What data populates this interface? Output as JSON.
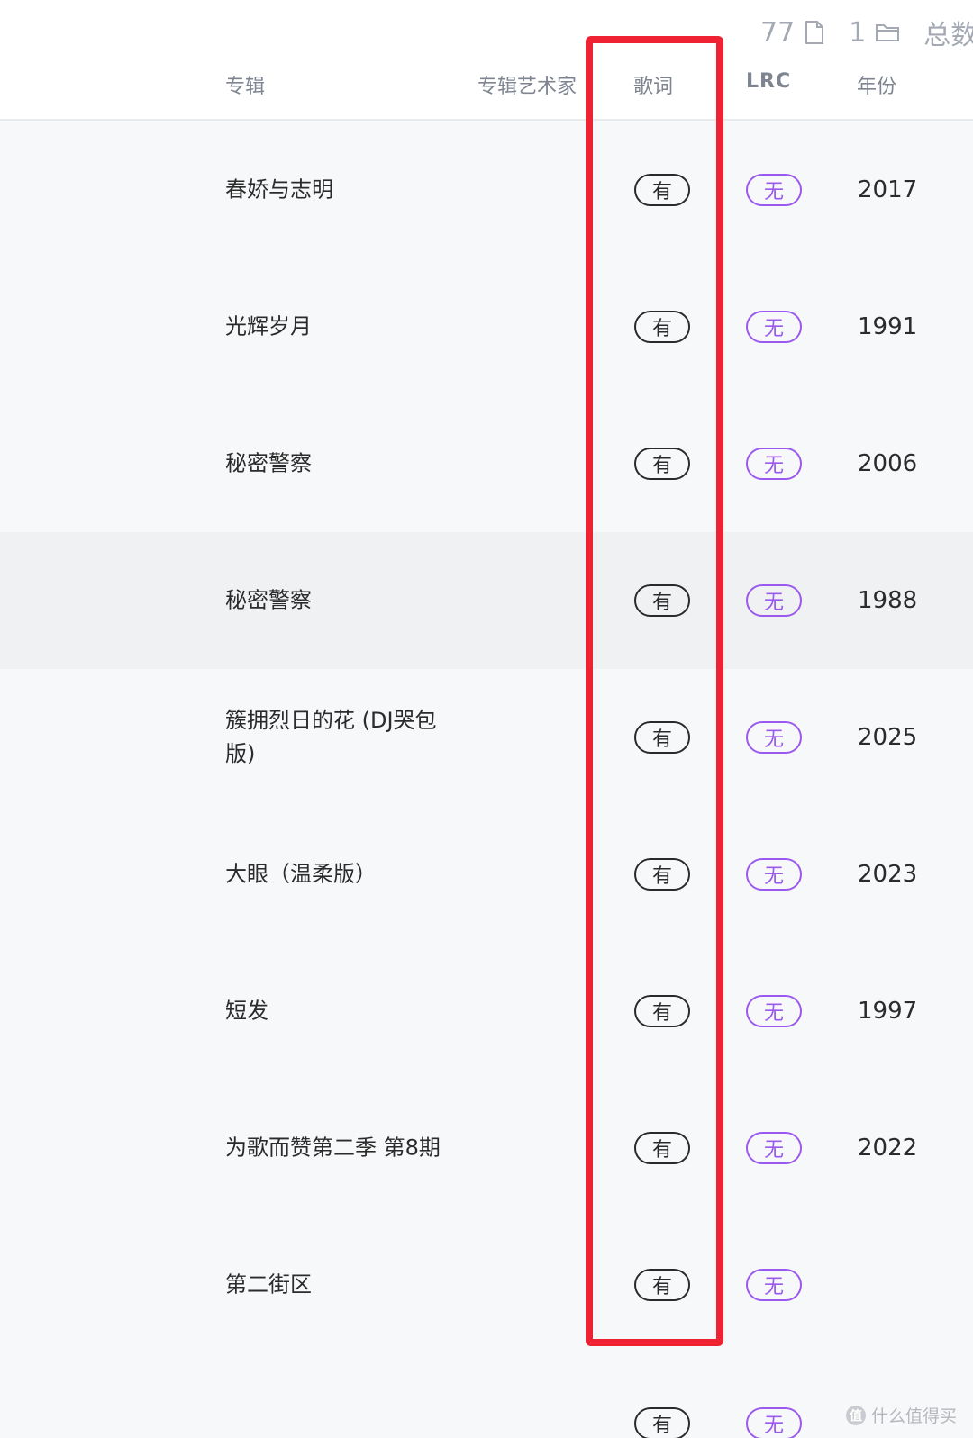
{
  "stats": {
    "file_count": "77",
    "file_icon": "file-icon",
    "folder_count": "1",
    "folder_icon": "folder-icon",
    "total_label": "总数"
  },
  "columns": {
    "album": "专辑",
    "album_artist": "专辑艺术家",
    "lyrics": "歌词",
    "lrc": "LRC",
    "year": "年份"
  },
  "rows": [
    {
      "album": "春娇与志明",
      "lyrics": "有",
      "lrc": "无",
      "year": "2017"
    },
    {
      "album": "光辉岁月",
      "lyrics": "有",
      "lrc": "无",
      "year": "1991"
    },
    {
      "album": "秘密警察",
      "lyrics": "有",
      "lrc": "无",
      "year": "2006"
    },
    {
      "album": "秘密警察",
      "lyrics": "有",
      "lrc": "无",
      "year": "1988"
    },
    {
      "album": "簇拥烈日的花 (DJ哭包版)",
      "lyrics": "有",
      "lrc": "无",
      "year": "2025"
    },
    {
      "album": "大眼（温柔版）",
      "lyrics": "有",
      "lrc": "无",
      "year": "2023"
    },
    {
      "album": "短发",
      "lyrics": "有",
      "lrc": "无",
      "year": "1997"
    },
    {
      "album": "为歌而赞第二季 第8期",
      "lyrics": "有",
      "lrc": "无",
      "year": "2022"
    },
    {
      "album": "第二街区",
      "lyrics": "有",
      "lrc": "无",
      "year": ""
    }
  ],
  "partial_row": {
    "lyrics": "有",
    "lrc": "无"
  },
  "highlight_color": "#ee2233",
  "lyrics_badge_color": "#2a2a2a",
  "lrc_badge_color": "#9b59f0",
  "watermark": {
    "icon": "值",
    "text": "什么值得买"
  }
}
